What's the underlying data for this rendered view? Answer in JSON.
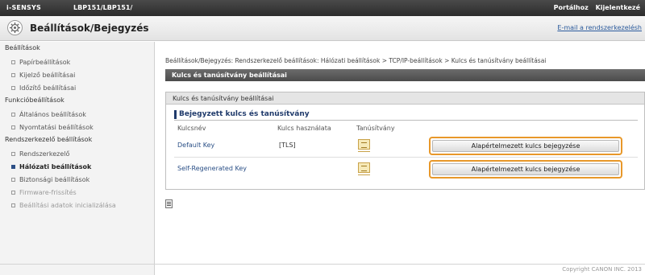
{
  "topbar": {
    "brand": "i-SENSYS",
    "model": "LBP151/LBP151/",
    "portal_link": "Portálhoz",
    "logout_link": "Kijelentkezé"
  },
  "header": {
    "icon": "gear-icon",
    "title": "Beállítások/Bejegyzés",
    "email_link": "E-mail a rendszerkezelésh"
  },
  "sidebar": {
    "sections": [
      {
        "label": "Beállítások",
        "items": [
          {
            "label": "Papírbeállítások",
            "state": "normal"
          },
          {
            "label": "Kijelző beállításai",
            "state": "normal"
          },
          {
            "label": "Időzítő beállításai",
            "state": "normal"
          }
        ]
      },
      {
        "label": "Funkcióbeállítások",
        "items": [
          {
            "label": "Általános beállítások",
            "state": "normal"
          },
          {
            "label": "Nyomtatási beállítások",
            "state": "normal"
          }
        ]
      },
      {
        "label": "Rendszerkezelő beállítások",
        "items": [
          {
            "label": "Rendszerkezelő",
            "state": "normal"
          },
          {
            "label": "Hálózati beállítások",
            "state": "active"
          },
          {
            "label": "Biztonsági beállítások",
            "state": "normal"
          },
          {
            "label": "Firmware-frissítés",
            "state": "dim"
          },
          {
            "label": "Beállítási adatok inicializálása",
            "state": "dim"
          }
        ]
      }
    ]
  },
  "main": {
    "breadcrumb": "Beállítások/Bejegyzés: Rendszerkezelő beállítások: Hálózati beállítások > TCP/IP-beállítások > Kulcs és tanúsítvány beállításai",
    "section_title": "Kulcs és tanúsítvány beállításai",
    "panel_title": "Kulcs és tanúsítvány beállításai",
    "subtitle": "Bejegyzett kulcs és tanúsítvány",
    "columns": [
      "Kulcsnév",
      "Kulcs használata",
      "Tanúsítvány"
    ],
    "rows": [
      {
        "key_name": "Default Key",
        "usage": "[TLS]",
        "cert_icon": "certificate-icon",
        "button": "Alapértelmezett kulcs bejegyzése"
      },
      {
        "key_name": "Self-Regenerated Key",
        "usage": "",
        "cert_icon": "certificate-icon",
        "button": "Alapértelmezett kulcs bejegyzése"
      }
    ],
    "back_icon": "back-list-icon"
  },
  "footer": {
    "copyright": "Copyright CANON INC. 2013"
  },
  "colors": {
    "highlight": "#e8982a",
    "section_bar": "#5a5a5a",
    "accent": "#1f3a6b"
  }
}
